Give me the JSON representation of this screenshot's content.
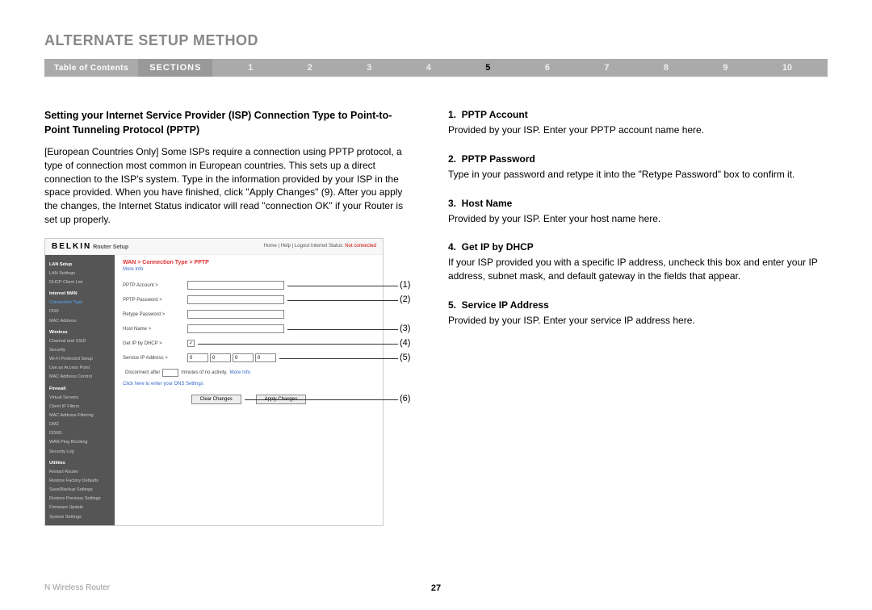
{
  "title": "ALTERNATE SETUP METHOD",
  "navbar": {
    "toc": "Table of Contents",
    "sections_label": "SECTIONS",
    "sections": [
      "1",
      "2",
      "3",
      "4",
      "5",
      "6",
      "7",
      "8",
      "9",
      "10"
    ],
    "active": "5"
  },
  "left": {
    "heading": "Setting your Internet Service Provider (ISP) Connection Type to Point-to-Point Tunneling Protocol (PPTP)",
    "para": "[European Countries Only] Some ISPs require a connection using PPTP protocol, a type of connection most common in European countries. This sets up a direct connection to the ISP's system. Type in the information provided by your ISP in the space provided. When you have finished, click \"Apply Changes\" (9). After you apply the changes, the Internet Status indicator will read \"connection OK\" if your Router is set up properly."
  },
  "right_items": [
    {
      "num": "1.",
      "title": "PPTP Account",
      "text": "Provided by your ISP. Enter your PPTP account name here."
    },
    {
      "num": "2.",
      "title": "PPTP Password",
      "text": "Type in your password and retype it into the \"Retype Password\" box to confirm it."
    },
    {
      "num": "3.",
      "title": "Host Name",
      "text": "Provided by your ISP. Enter your host name here."
    },
    {
      "num": "4.",
      "title": "Get IP by DHCP",
      "text": "If your ISP provided you with a specific IP address, uncheck this box and enter your IP address, subnet mask, and default gateway in the fields that appear."
    },
    {
      "num": "5.",
      "title": "Service IP Address",
      "text": "Provided by your ISP. Enter your service IP address here."
    }
  ],
  "router": {
    "logo": "BELKIN",
    "subtitle": "Router Setup",
    "toplinks": "Home | Help | Logout   Internet Status:",
    "status": "Not connected",
    "sidebar": {
      "groups": [
        {
          "hdr": "LAN Setup",
          "items": [
            "LAN Settings",
            "DHCP Client List"
          ]
        },
        {
          "hdr": "Internet WAN",
          "items": [
            {
              "label": "Connection Type",
              "active": true
            },
            "DNS",
            "MAC Address"
          ]
        },
        {
          "hdr": "Wireless",
          "items": [
            "Channel and SSID",
            "Security",
            "Wi-Fi Protected Setup",
            "Use as Access Point",
            "MAC Address Control"
          ]
        },
        {
          "hdr": "Firewall",
          "items": [
            "Virtual Servers",
            "Client IP Filters",
            "MAC Address Filtering",
            "DMZ",
            "DDNS",
            "WAN Ping Blocking",
            "Security Log"
          ]
        },
        {
          "hdr": "Utilities",
          "items": [
            "Restart Router",
            "Restore Factory Defaults",
            "Save/Backup Settings",
            "Restore Previous Settings",
            "Firmware Update",
            "System Settings"
          ]
        }
      ]
    },
    "breadcrumb": "WAN > Connection Type > PPTP",
    "moreinfo": "More Info",
    "fields": {
      "account": "PPTP Account >",
      "password": "PPTP Password >",
      "retype": "Retype Password >",
      "host": "Host Name >",
      "dhcp": "Get IP by DHCP >",
      "service": "Service IP Address >"
    },
    "ip_default": "0",
    "disconnect": {
      "prefix": "Disconnect after",
      "suffix": "minutes of no activity.",
      "more": "More Info"
    },
    "dns_link": "Click here to enter your DNS Settings",
    "buttons": {
      "clear": "Clear Changes",
      "apply": "Apply Changes"
    }
  },
  "callouts": [
    "(1)",
    "(2)",
    "(3)",
    "(4)",
    "(5)",
    "(6)"
  ],
  "footer": {
    "product": "N Wireless Router",
    "page": "27"
  }
}
